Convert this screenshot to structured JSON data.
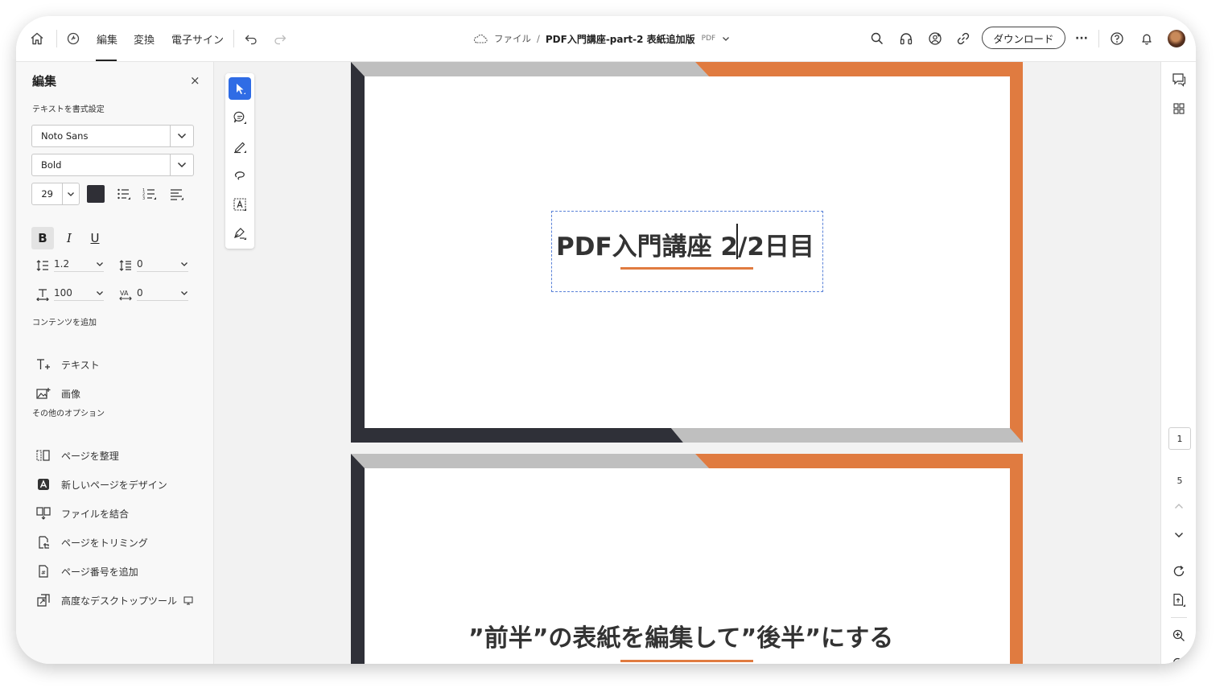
{
  "topbar": {
    "tabs": [
      {
        "label": "編集",
        "active": true
      },
      {
        "label": "変換",
        "active": false
      },
      {
        "label": "電子サイン",
        "active": false
      }
    ],
    "breadcrumb": {
      "root": "ファイル",
      "separator": "/",
      "filename": "PDF入門講座-part-2 表紙追加版",
      "filetype": "PDF"
    },
    "download_label": "ダウンロード",
    "more_label": "···"
  },
  "left_panel": {
    "title": "編集",
    "close_label": "×",
    "format_section": "テキストを書式設定",
    "font_family": "Noto Sans",
    "font_weight": "Bold",
    "font_size": "29",
    "text_color": "#2f2f36",
    "bold_label": "B",
    "italic_label": "I",
    "underline_label": "U",
    "line_spacing": "1.2",
    "paragraph_spacing": "0",
    "horizontal_scale": "100",
    "char_spacing": "0",
    "add_content_section": "コンテンツを追加",
    "add_content_items": [
      {
        "label": "テキスト",
        "icon": "add-text-icon"
      },
      {
        "label": "画像",
        "icon": "add-image-icon"
      }
    ],
    "other_section": "その他のオプション",
    "other_items": [
      {
        "label": "ページを整理",
        "icon": "organize-pages-icon"
      },
      {
        "label": "新しいページをデザイン",
        "icon": "adobe-express-icon"
      },
      {
        "label": "ファイルを結合",
        "icon": "combine-files-icon"
      },
      {
        "label": "ページをトリミング",
        "icon": "crop-pages-icon"
      },
      {
        "label": "ページ番号を追加",
        "icon": "page-number-icon"
      },
      {
        "label": "高度なデスクトップツール",
        "icon": "desktop-tools-icon"
      }
    ]
  },
  "document": {
    "page1_title": "PDF入門講座 2/2日目",
    "page2_title": "”前半”の表紙を編集して”後半”にする",
    "colors": {
      "orange": "#e07b40",
      "dark": "#2f3038",
      "gray": "#bfbfbf"
    }
  },
  "right_rail": {
    "current_page": "1",
    "total_pages": "5"
  }
}
